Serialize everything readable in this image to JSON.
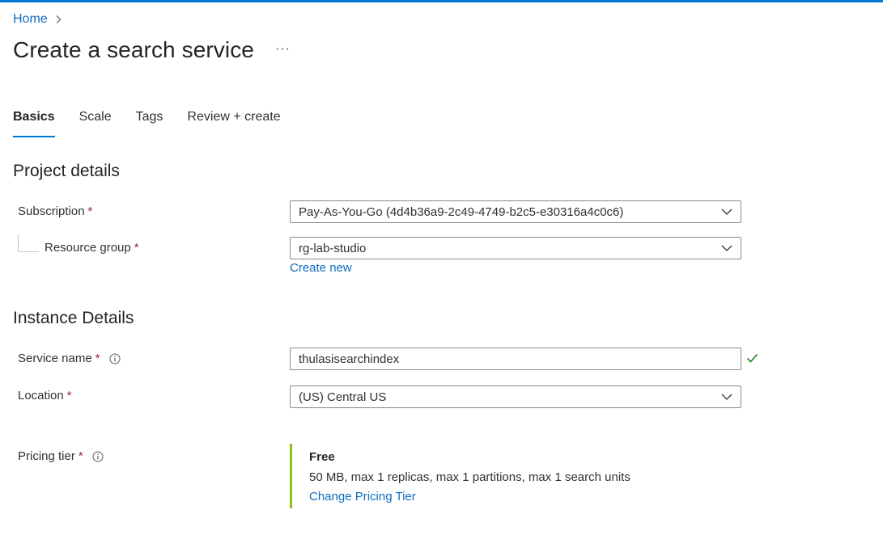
{
  "breadcrumb": {
    "home": "Home"
  },
  "page": {
    "title": "Create a search service",
    "more": "···"
  },
  "tabs": [
    {
      "label": "Basics"
    },
    {
      "label": "Scale"
    },
    {
      "label": "Tags"
    },
    {
      "label": "Review + create"
    }
  ],
  "project_details": {
    "title": "Project details",
    "subscription": {
      "label": "Subscription",
      "value": "Pay-As-You-Go (4d4b36a9-2c49-4749-b2c5-e30316a4c0c6)"
    },
    "resource_group": {
      "label": "Resource group",
      "value": "rg-lab-studio",
      "create_new": "Create new"
    }
  },
  "instance_details": {
    "title": "Instance Details",
    "service_name": {
      "label": "Service name",
      "value": "thulasisearchindex"
    },
    "location": {
      "label": "Location",
      "value": "(US) Central US"
    }
  },
  "pricing": {
    "label": "Pricing tier",
    "tier": "Free",
    "description": "50 MB, max 1 replicas, max 1 partitions, max 1 search units",
    "change_link": "Change Pricing Tier"
  },
  "required_marker": "*",
  "icons": {
    "info": "info-icon",
    "chevron": "chevron-down-icon",
    "check": "check-icon"
  },
  "colors": {
    "accent": "#0078d4",
    "link": "#0f6cbd",
    "required": "#a4262c",
    "valid": "#107c10",
    "tier_bar": "#8cbd18"
  }
}
